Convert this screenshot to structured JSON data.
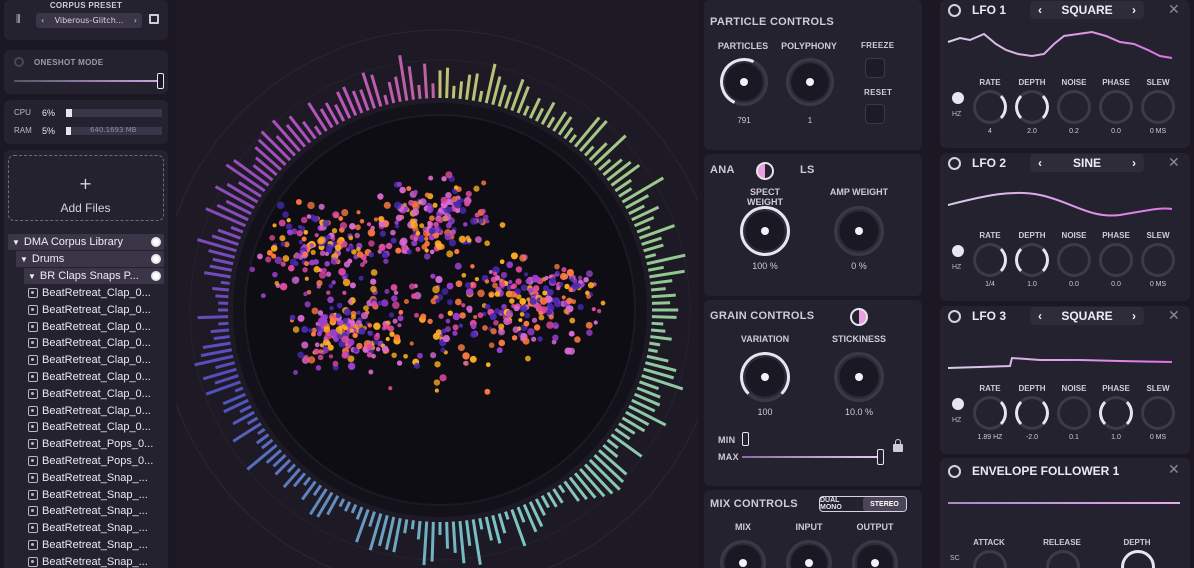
{
  "corpus_preset": {
    "label": "CORPUS PRESET",
    "value": "Viberous-Glitch..."
  },
  "oneshot": {
    "label": "ONESHOT MODE"
  },
  "meters": {
    "cpu_label": "CPU",
    "cpu_value": "6%",
    "cpu_level": 0.06,
    "ram_label": "RAM",
    "ram_value": "5%",
    "ram_level": 0.05,
    "ram_detail": "640.1693 MB"
  },
  "add_files": {
    "label": "Add Files"
  },
  "tree": {
    "library": "DMA Corpus Library",
    "folder": "Drums",
    "subfolder": "BR Claps Snaps P...",
    "files": [
      "BeatRetreat_Clap_0...",
      "BeatRetreat_Clap_0...",
      "BeatRetreat_Clap_0...",
      "BeatRetreat_Clap_0...",
      "BeatRetreat_Clap_0...",
      "BeatRetreat_Clap_0...",
      "BeatRetreat_Clap_0...",
      "BeatRetreat_Clap_0...",
      "BeatRetreat_Clap_0...",
      "BeatRetreat_Pops_0...",
      "BeatRetreat_Pops_0...",
      "BeatRetreat_Snap_...",
      "BeatRetreat_Snap_...",
      "BeatRetreat_Snap_...",
      "BeatRetreat_Snap_...",
      "BeatRetreat_Snap_...",
      "BeatRetreat_Snap_..."
    ]
  },
  "particle": {
    "title": "PARTICLE CONTROLS",
    "particles_label": "PARTICLES",
    "particles_value": "791",
    "polyphony_label": "POLYPHONY",
    "polyphony_value": "1",
    "freeze_label": "FREEZE",
    "reset_label": "RESET"
  },
  "analysis": {
    "title_left": "ANA",
    "title_right": "LS",
    "spect_label": "SPECT WEIGHT",
    "spect_value": "100 %",
    "amp_label": "AMP WEIGHT",
    "amp_value": "0 %"
  },
  "grain": {
    "title": "GRAIN CONTROLS",
    "variation_label": "VARIATION",
    "variation_value": "100",
    "stickiness_label": "STICKINESS",
    "stickiness_value": "10.0 %",
    "min_label": "MIN",
    "max_label": "MAX"
  },
  "mix": {
    "title": "MIX CONTROLS",
    "mode_dual": "DUAL MONO",
    "mode_stereo": "STEREO",
    "mix_label": "MIX",
    "input_label": "INPUT",
    "output_label": "OUTPUT"
  },
  "lfos": [
    {
      "title": "LFO 1",
      "shape": "SQUARE",
      "unit": "HZ",
      "labels": [
        "RATE",
        "DEPTH",
        "NOISE",
        "PHASE",
        "SLEW"
      ],
      "values": [
        "4",
        "2.0",
        "0.2",
        "0.0",
        "0 MS"
      ]
    },
    {
      "title": "LFO 2",
      "shape": "SINE",
      "unit": "HZ",
      "labels": [
        "RATE",
        "DEPTH",
        "NOISE",
        "PHASE",
        "SLEW"
      ],
      "values": [
        "1/4",
        "1.0",
        "0.0",
        "0.0",
        "0 MS"
      ]
    },
    {
      "title": "LFO 3",
      "shape": "SQUARE",
      "unit": "HZ",
      "labels": [
        "RATE",
        "DEPTH",
        "NOISE",
        "PHASE",
        "SLEW"
      ],
      "values": [
        "1.89 HZ",
        "-2.0",
        "0.1",
        "1.0",
        "0 MS"
      ]
    }
  ],
  "envelope": {
    "title": "ENVELOPE FOLLOWER 1",
    "unit": "SC",
    "attack_label": "ATTACK",
    "release_label": "RELEASE",
    "depth_label": "DEPTH"
  },
  "colors": {
    "accent": "#c86ad6",
    "panel": "#25222f",
    "bg": "#1b1824"
  }
}
